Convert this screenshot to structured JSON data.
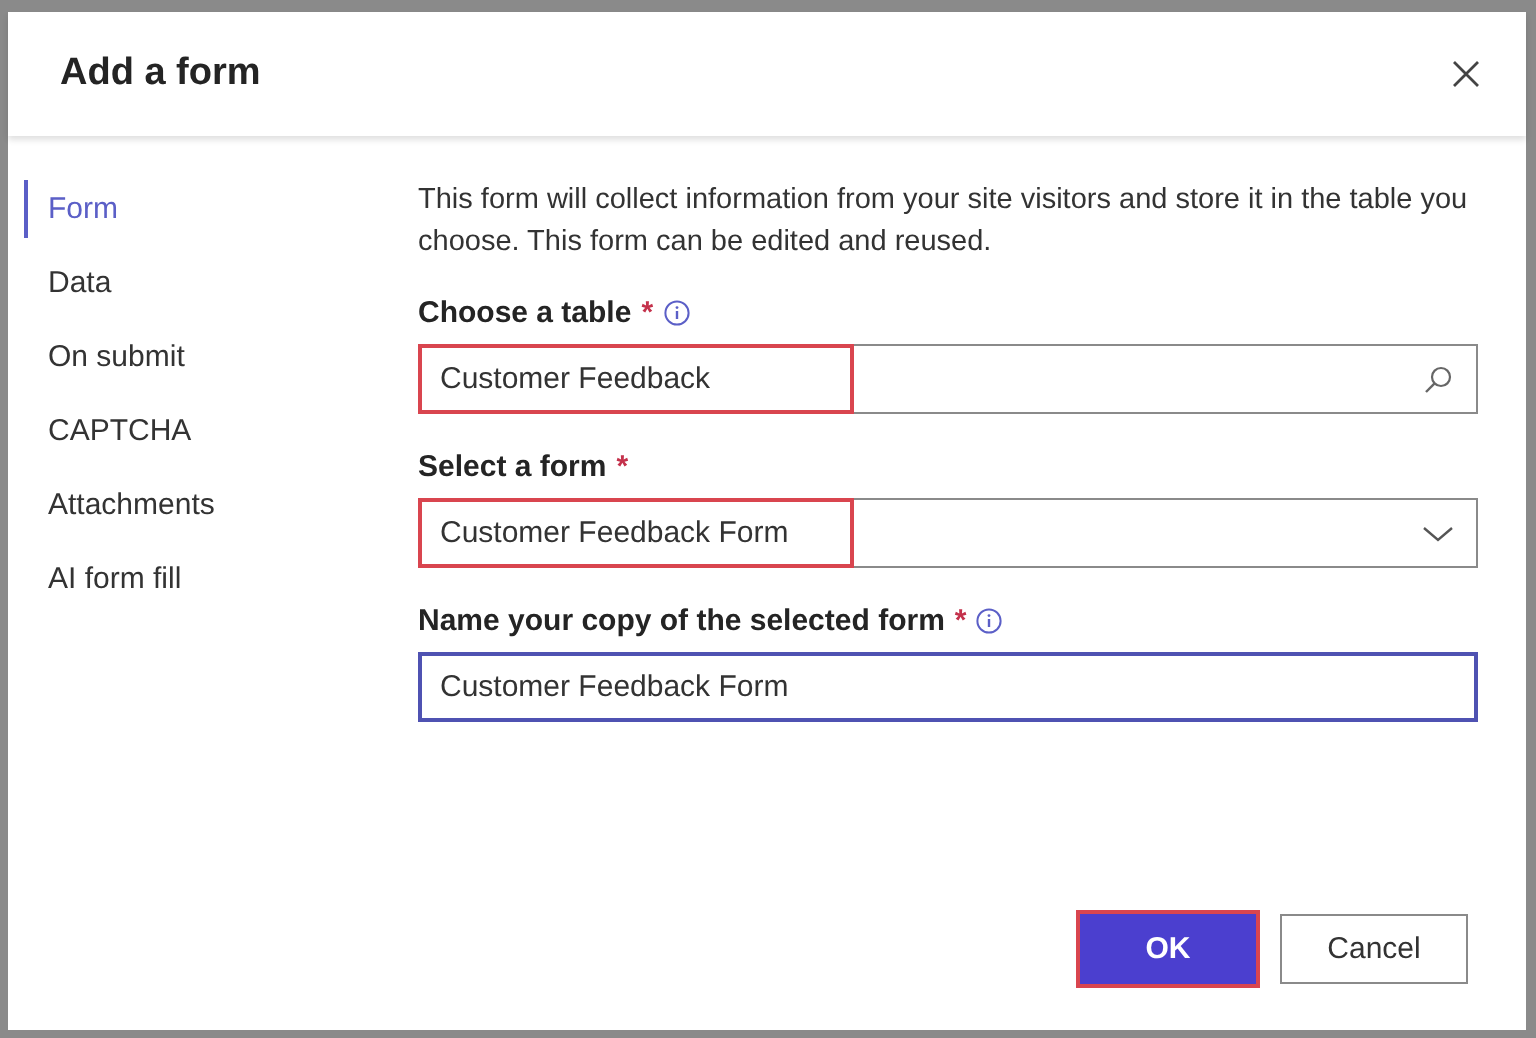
{
  "dialog": {
    "title": "Add a form"
  },
  "sidebar": {
    "items": [
      {
        "label": "Form",
        "selected": true
      },
      {
        "label": "Data",
        "selected": false
      },
      {
        "label": "On submit",
        "selected": false
      },
      {
        "label": "CAPTCHA",
        "selected": false
      },
      {
        "label": "Attachments",
        "selected": false
      },
      {
        "label": "AI form fill",
        "selected": false
      }
    ]
  },
  "description": "This form will collect information from your site visitors and store it in the table you choose. This form can be edited and reused.",
  "fields": [
    {
      "kind": "search",
      "label": "Choose a table",
      "required_mark": "*",
      "info": true,
      "value": "Customer Feedback",
      "highlighted": true,
      "focused": false
    },
    {
      "kind": "dropdown",
      "label": "Select a form",
      "required_mark": "*",
      "info": false,
      "value": "Customer Feedback Form",
      "highlighted": true,
      "focused": false
    },
    {
      "kind": "text",
      "label": "Name your copy of the selected form",
      "required_mark": "*",
      "info": true,
      "value": "Customer Feedback Form",
      "highlighted": false,
      "focused": true
    }
  ],
  "buttons": [
    {
      "label": "OK",
      "kind": "primary",
      "highlighted": true
    },
    {
      "label": "Cancel",
      "kind": "secondary",
      "highlighted": false
    }
  ]
}
